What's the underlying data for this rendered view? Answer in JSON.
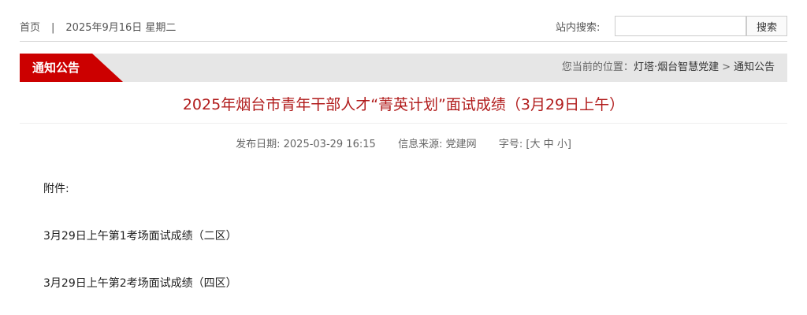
{
  "topbar": {
    "home": "首页",
    "separator": "|",
    "date": "2025年9月16日 星期二",
    "search_label": "站内搜索:",
    "search_value": "",
    "search_button": "搜索"
  },
  "section": {
    "tab": "通知公告",
    "crumb_prefix": "您当前的位置：",
    "crumb_site": "灯塔·烟台智慧党建",
    "crumb_arrow": ">",
    "crumb_current": "通知公告"
  },
  "article": {
    "title": "2025年烟台市青年干部人才“菁英计划”面试成绩（3月29日上午）",
    "publish_label": "发布日期:",
    "publish_date": "2025-03-29 16:15",
    "source_label": "信息来源:",
    "source": "党建网",
    "fontsize_label": "字号:",
    "bracket_open": "[",
    "size_large": "大",
    "size_medium": "中",
    "size_small": "小",
    "bracket_close": "]",
    "attachments_label": "附件:",
    "attachments": [
      "3月29日上午第1考场面试成绩（二区）",
      "3月29日上午第2考场面试成绩（四区）"
    ]
  }
}
